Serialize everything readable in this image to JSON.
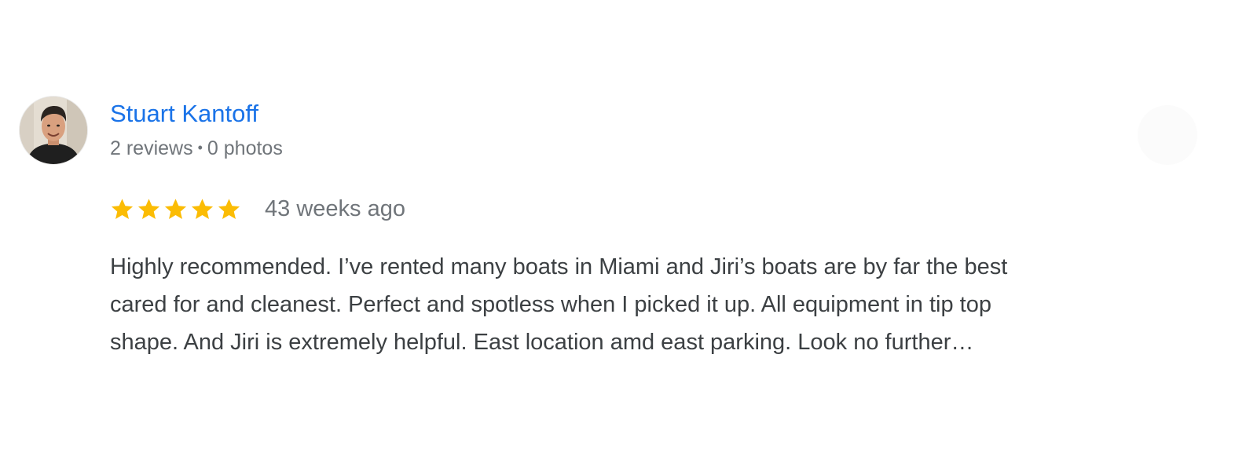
{
  "review": {
    "reviewer": {
      "name": "Stuart Kantoff",
      "reviews_count": "2 reviews",
      "separator": "•",
      "photos_count": "0 photos",
      "avatar_icon": "person-photo-avatar"
    },
    "rating": {
      "value": 5,
      "max": 5,
      "star_icon": "star-icon",
      "star_color": "#fbbc04"
    },
    "time": "43 weeks ago",
    "text_lines": [
      "Highly recommended. I’ve rented many boats in Miami and Jiri’s boats are by far the best",
      "cared for and cleanest. Perfect and spotless when I picked it up. All equipment in tip top",
      "shape. And Jiri is extremely helpful. East location amd east parking. Look no further…"
    ],
    "colors": {
      "name_link": "#1a73e8",
      "meta_text": "#70757a",
      "body_text": "#3c4043"
    }
  }
}
